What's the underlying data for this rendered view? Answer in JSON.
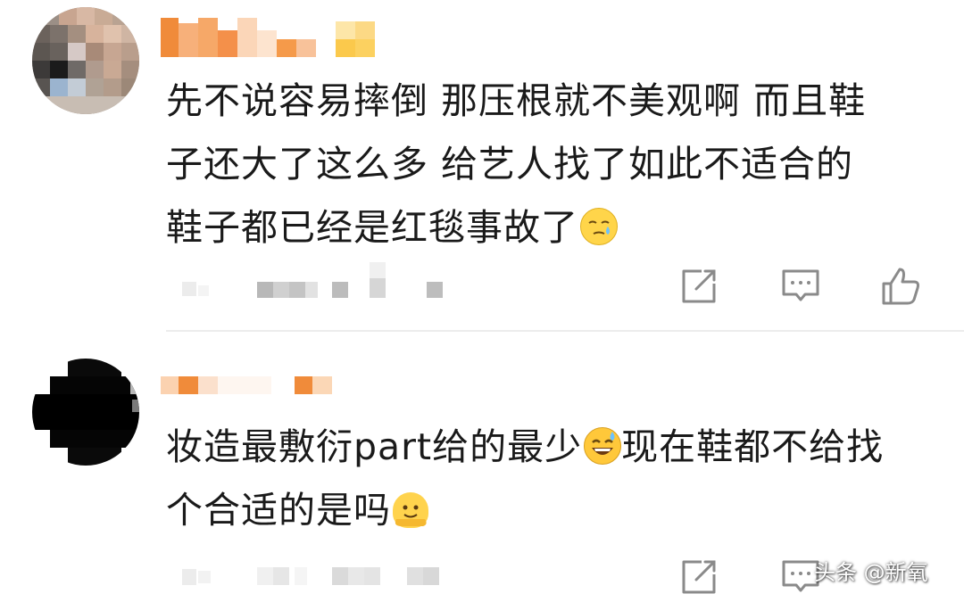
{
  "comments": [
    {
      "username": "",
      "text": "先不说容易摔倒 那压根就不美观啊 而且鞋子还大了这么多 给艺人找了如此不适合的鞋子都已经是红毯事故了",
      "text_lines": [
        "先不说容易摔倒 那压根就不美观啊 而且鞋",
        "子还大了这么多 给艺人找了如此不适合的",
        "鞋子都已经是红毯事故了"
      ],
      "emoji": "sleepy-sweat-emoji",
      "actions": [
        "share-icon",
        "comment-icon",
        "like-icon"
      ]
    },
    {
      "username": "",
      "text_lines": [
        "妆造最敷衍part给的最少",
        "现在鞋都不给找",
        "个合适的是吗"
      ],
      "emojis": [
        "grinning-sweat-emoji",
        "melting-face-emoji"
      ],
      "actions": [
        "share-icon",
        "comment-icon"
      ]
    }
  ],
  "watermark": "头条 @新氧",
  "colors": {
    "text": "#1a1a1a",
    "icon": "#8a8a8a",
    "divider": "#ececec",
    "name_blur_orange": "#f59a4a"
  }
}
